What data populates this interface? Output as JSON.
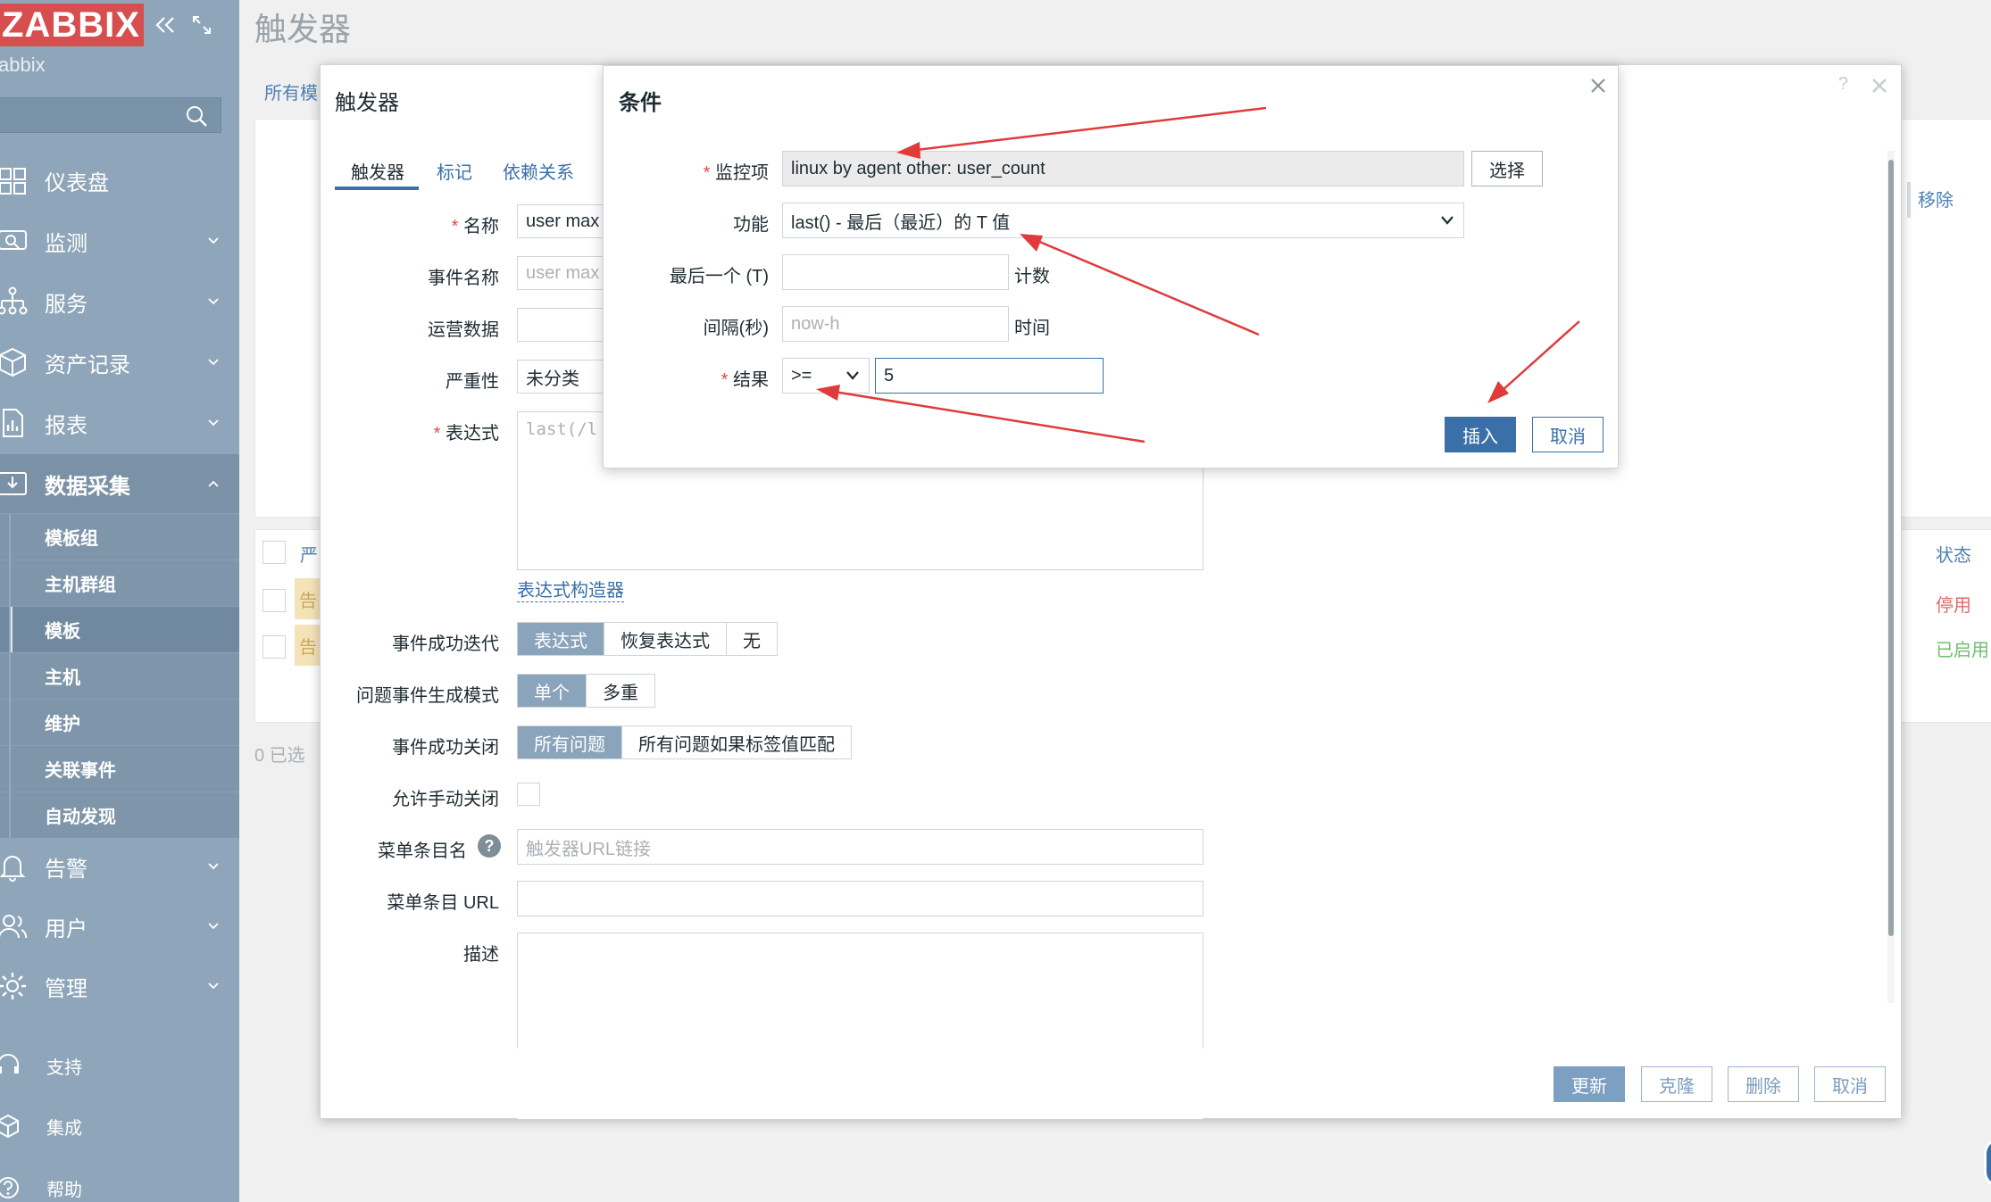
{
  "sidebar": {
    "logo": "ZABBIX",
    "server_name": "abbix",
    "menu": [
      {
        "label": "仪表盘",
        "icon": "dashboard-icon"
      },
      {
        "label": "监测",
        "icon": "monitoring-icon"
      },
      {
        "label": "服务",
        "icon": "services-icon"
      },
      {
        "label": "资产记录",
        "icon": "inventory-icon"
      },
      {
        "label": "报表",
        "icon": "reports-icon"
      },
      {
        "label": "数据采集",
        "icon": "data-collection-icon"
      }
    ],
    "submenu": [
      "模板组",
      "主机群组",
      "模板",
      "主机",
      "维护",
      "关联事件",
      "自动发现"
    ],
    "menu2": [
      {
        "label": "告警",
        "icon": "alerts-icon"
      },
      {
        "label": "用户",
        "icon": "users-icon"
      },
      {
        "label": "管理",
        "icon": "administration-icon"
      }
    ],
    "footer": [
      {
        "label": "支持",
        "icon": "support-icon"
      },
      {
        "label": "集成",
        "icon": "integrations-icon"
      },
      {
        "label": "帮助",
        "icon": "help-icon"
      }
    ]
  },
  "page": {
    "title": "触发器",
    "breadcrumb": "所有模",
    "remove_link": "移除",
    "status_header": "状态",
    "col_header_partial": "严",
    "status_disabled": "停用",
    "status_enabled": "已启用",
    "row_badge": "告",
    "selected_count": "0 已选"
  },
  "trigger_form": {
    "title": "触发器",
    "tabs": [
      "触发器",
      "标记",
      "依赖关系"
    ],
    "labels": {
      "name": "名称",
      "event_name": "事件名称",
      "opdata": "运营数据",
      "severity": "严重性",
      "expression": "表达式",
      "ok_event_gen": "事件成功迭代",
      "problem_mode": "问题事件生成模式",
      "ok_event_close": "事件成功关闭",
      "manual_close": "允许手动关闭",
      "url_name": "菜单条目名",
      "url": "菜单条目 URL",
      "description": "描述"
    },
    "values": {
      "name": "user max",
      "event_name_placeholder": "user max",
      "severity": "未分类",
      "expression": "last(/l",
      "url_name_placeholder": "触发器URL链接"
    },
    "expression_builder": "表达式构造器",
    "ok_event_gen_options": [
      "表达式",
      "恢复表达式",
      "无"
    ],
    "problem_mode_options": [
      "单个",
      "多重"
    ],
    "ok_close_options": [
      "所有问题",
      "所有问题如果标签值匹配"
    ],
    "buttons": {
      "update": "更新",
      "clone": "克隆",
      "delete": "删除",
      "cancel": "取消"
    }
  },
  "condition_dialog": {
    "title": "条件",
    "labels": {
      "item": "监控项",
      "function": "功能",
      "last_of": "最后一个 (T)",
      "period": "间隔(秒)",
      "result": "结果"
    },
    "item_value": "linux by agent other: user_count",
    "select_button": "选择",
    "function_value": "last() - 最后（最近）的 T 值",
    "last_of_suffix": "计数",
    "period_placeholder": "now-h",
    "period_suffix": "时间",
    "operator": ">=",
    "result_value": "5",
    "insert_button": "插入",
    "cancel_button": "取消"
  },
  "colors": {
    "sidebar": "#8fa6ba",
    "logo_bg": "#d64e4e",
    "accent": "#3a6fa8",
    "annotation_arrow": "#e03a3a",
    "status_disabled": "#e06a6a",
    "status_enabled": "#6fbf6f"
  }
}
